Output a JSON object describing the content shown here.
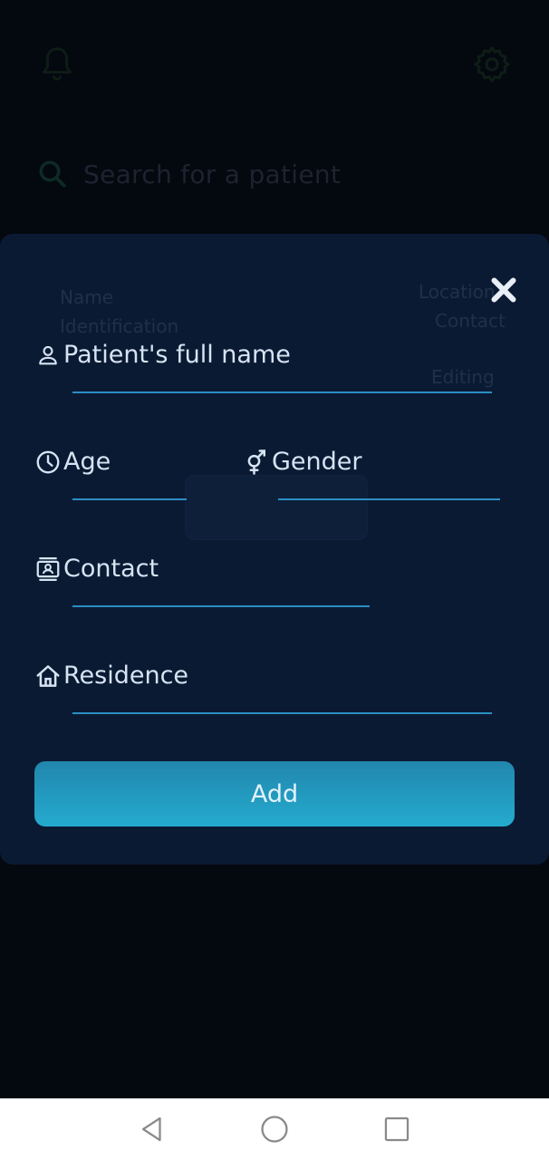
{
  "background": {
    "search_placeholder": "Search for a patient",
    "ghost_texts": [
      "Name",
      "Identification",
      "Location",
      "Contact",
      "Editing"
    ]
  },
  "modal": {
    "close_icon": "close-icon",
    "fields": {
      "full_name": {
        "label": "Patient's full name",
        "icon": "person-icon"
      },
      "age": {
        "label": "Age",
        "icon": "clock-icon"
      },
      "gender": {
        "label": "Gender",
        "icon": "gender-icon"
      },
      "contact": {
        "label": "Contact",
        "icon": "contact-card-icon"
      },
      "residence": {
        "label": "Residence",
        "icon": "home-icon"
      }
    },
    "add_button": {
      "label": "Add"
    }
  },
  "colors": {
    "modal_bg": "#0b1a33",
    "accent": "#2a8ec4",
    "button_gradient_top": "#2286ad",
    "button_gradient_bottom": "#24abcf",
    "label": "#d6e3f2"
  },
  "navbar": {
    "back_icon": "back-triangle-icon",
    "home_icon": "home-circle-icon",
    "recents_icon": "recents-square-icon"
  }
}
